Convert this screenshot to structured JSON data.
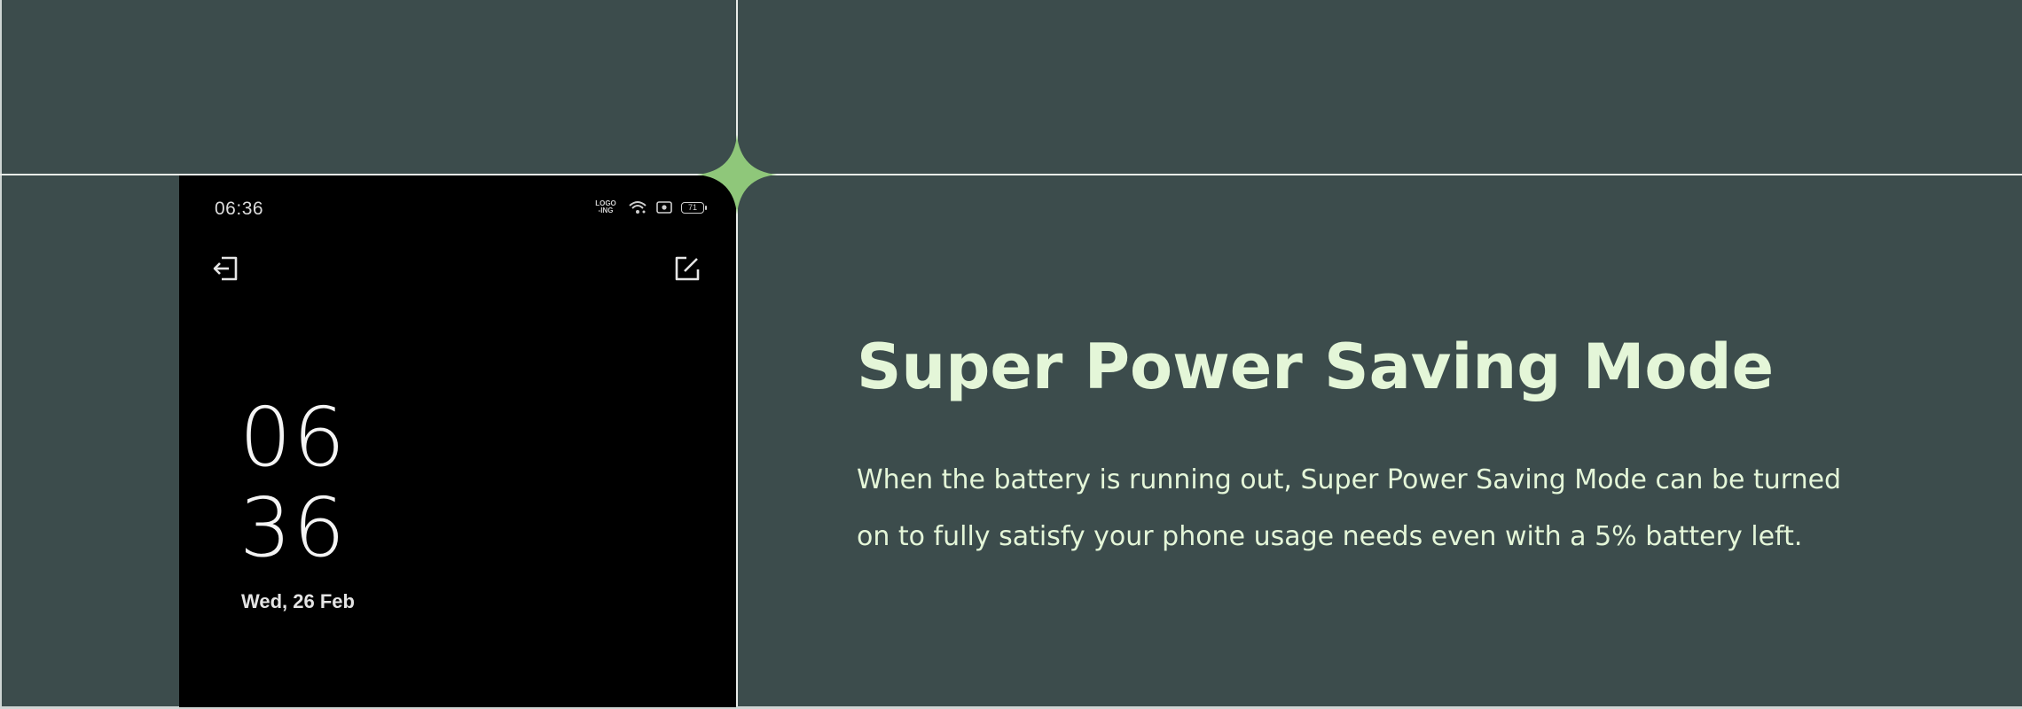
{
  "colors": {
    "background": "#3c4c4c",
    "accent": "#8fc77a",
    "text": "#e4f6d8",
    "phone_screen": "#000000"
  },
  "phone": {
    "status_bar": {
      "time": "06:36",
      "network_label": "LOGO\n-ING",
      "icons": [
        "network-icon",
        "wifi-icon",
        "screen-record-icon",
        "battery-icon"
      ],
      "battery": "71"
    },
    "toolbar": {
      "exit_icon": "exit-icon",
      "edit_icon": "edit-icon"
    },
    "clock": {
      "hour": "06",
      "minute": "36"
    },
    "date": "Wed, 26 Feb"
  },
  "feature": {
    "title": "Super Power Saving Mode",
    "description": "When the battery is running out, Super Power Saving Mode can be turned on to fully satisfy your phone usage needs even with a 5% battery left."
  }
}
